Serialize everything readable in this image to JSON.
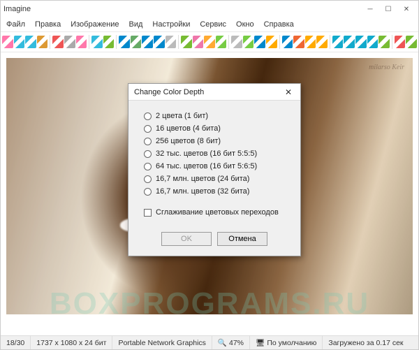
{
  "window": {
    "title": "Imagine"
  },
  "menu": {
    "file": "Файл",
    "edit": "Правка",
    "image": "Изображение",
    "view": "Вид",
    "settings": "Настройки",
    "service": "Сервис",
    "window_": "Окно",
    "help": "Справка"
  },
  "toolbar_colors": [
    "#f7a",
    "#3bd",
    "#3bd",
    "#d93",
    "#e55",
    "#aaa",
    "#f7a",
    "#3bd",
    "#7b3",
    "#08c",
    "#6a6",
    "#08c",
    "#08c",
    "#bbb",
    "#7b3",
    "#e7a",
    "#fa3",
    "#7c4",
    "#bbb",
    "#7c4",
    "#08c",
    "#fa0",
    "#08c",
    "#e63",
    "#fa0",
    "#fa0",
    "#1ac",
    "#1ac",
    "#1ac",
    "#1ac",
    "#7b3",
    "#e55",
    "#7b3"
  ],
  "watermark_sig": "milarso Keir",
  "watermark_main": "BOXPROGRAMS.RU",
  "dialog": {
    "title": "Change Color Depth",
    "options": [
      "2 цвета (1 бит)",
      "16 цветов (4 бита)",
      "256 цветов (8 бит)",
      "32 тыс. цветов (16 бит 5:5:5)",
      "64 тыс. цветов (16 бит 5:6:5)",
      "16,7 млн. цветов (24 бита)",
      "16,7 млн. цветов (32 бита)"
    ],
    "smooth": "Сглаживание цветовых переходов",
    "ok": "OK",
    "cancel": "Отмена"
  },
  "status": {
    "page": "18/30",
    "dims": "1737 x 1080 x 24 бит",
    "format": "Portable Network Graphics",
    "zoom": "47%",
    "mode": "По умолчанию",
    "loaded": "Загружено за 0.17 сек"
  }
}
